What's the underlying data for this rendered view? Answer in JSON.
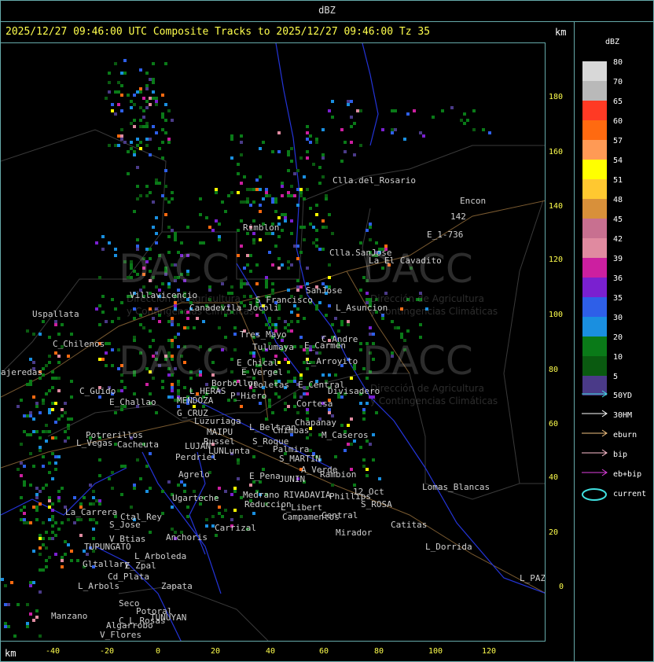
{
  "header": {
    "title": "dBZ"
  },
  "subtitle": "2025/12/27 09:46:00 UTC Composite Tracks to 2025/12/27 09:46:00 Tz 35",
  "axis": {
    "unit": "km",
    "y_ticks": [
      "180",
      "160",
      "140",
      "120",
      "100",
      "80",
      "60",
      "40",
      "20",
      "0"
    ],
    "x_ticks": [
      "-40",
      "-20",
      "0",
      "20",
      "40",
      "60",
      "80",
      "100",
      "120"
    ]
  },
  "legend": {
    "title": "dBZ",
    "levels": [
      {
        "label": "80",
        "color": "#d8d8d8"
      },
      {
        "label": "70",
        "color": "#b9b9b9"
      },
      {
        "label": "65",
        "color": "#ff3a24"
      },
      {
        "label": "60",
        "color": "#ff6a10"
      },
      {
        "label": "57",
        "color": "#ff9a55"
      },
      {
        "label": "54",
        "color": "#ffff00"
      },
      {
        "label": "51",
        "color": "#ffc830"
      },
      {
        "label": "48",
        "color": "#d8903a"
      },
      {
        "label": "45",
        "color": "#c87090"
      },
      {
        "label": "42",
        "color": "#e08aa0"
      },
      {
        "label": "39",
        "color": "#cc1fa0"
      },
      {
        "label": "36",
        "color": "#7a20d0"
      },
      {
        "label": "35",
        "color": "#2e5fe8"
      },
      {
        "label": "30",
        "color": "#1a8fe0"
      },
      {
        "label": "20",
        "color": "#0a7a18"
      },
      {
        "label": "10",
        "color": "#0a5a10"
      },
      {
        "label": "5",
        "color": "#4a3a88"
      }
    ],
    "tracks": [
      {
        "label": "50YD",
        "color": "#40e0e0"
      },
      {
        "label": "30HM",
        "color": "#ffffff"
      },
      {
        "label": "eburn",
        "color": "#f0c080"
      },
      {
        "label": "bip",
        "color": "#ffc0d0"
      },
      {
        "label": "eb+bip",
        "color": "#e040e0"
      },
      {
        "label": "current",
        "color": "#40e0e0"
      }
    ]
  },
  "watermark": {
    "brand": "DACC",
    "line1": "Dirección de Agricultura",
    "line2": "y Contingencias Climáticas"
  },
  "towns": [
    {
      "name": "Clla.del_Rosario"
    },
    {
      "name": "Encon"
    },
    {
      "name": "E_1-736"
    },
    {
      "name": "142"
    },
    {
      "name": "Rimblon"
    },
    {
      "name": "Clla.SanJose"
    },
    {
      "name": "La El Cavadito"
    },
    {
      "name": "Villavicencio"
    },
    {
      "name": "S_Francisco"
    },
    {
      "name": "SanJose"
    },
    {
      "name": "Uspallata"
    },
    {
      "name": "Canadevila"
    },
    {
      "name": "Jocoli"
    },
    {
      "name": "L_Asuncion"
    },
    {
      "name": "Tres_Mayo"
    },
    {
      "name": "C_Andre"
    },
    {
      "name": "C_Chilenos"
    },
    {
      "name": "Tulumaya"
    },
    {
      "name": "E_Carmen"
    },
    {
      "name": "E_Chical"
    },
    {
      "name": "L_Arroyito"
    },
    {
      "name": "E_Vergel"
    },
    {
      "name": "ajeredas"
    },
    {
      "name": "Borbollon"
    },
    {
      "name": "Violetas"
    },
    {
      "name": "E_Central"
    },
    {
      "name": "C_Guido"
    },
    {
      "name": "L_HERAS"
    },
    {
      "name": "P_Hiero"
    },
    {
      "name": "Divisadero"
    },
    {
      "name": "E_Challao"
    },
    {
      "name": "MENDOZA"
    },
    {
      "name": "Cortesa"
    },
    {
      "name": "G_CRUZ"
    },
    {
      "name": "Luzuriaga"
    },
    {
      "name": "Chapanay"
    },
    {
      "name": "MAIPU"
    },
    {
      "name": "L_Beltran"
    },
    {
      "name": "Potrerillos"
    },
    {
      "name": "Russel"
    },
    {
      "name": "Chimbas"
    },
    {
      "name": "M_Caseros"
    },
    {
      "name": "L_Vegas"
    },
    {
      "name": "Cacheuta"
    },
    {
      "name": "LUJAN"
    },
    {
      "name": "S_Roque"
    },
    {
      "name": "LUNLunta"
    },
    {
      "name": "Palmira"
    },
    {
      "name": "Perdriel"
    },
    {
      "name": "S_MARTIN"
    },
    {
      "name": "A_Verde"
    },
    {
      "name": "Agrelo"
    },
    {
      "name": "E_Pena"
    },
    {
      "name": "JUNIN"
    },
    {
      "name": "Rambion"
    },
    {
      "name": "12_Oct"
    },
    {
      "name": "Lomas_Blancas"
    },
    {
      "name": "Ugarteche"
    },
    {
      "name": "Medrano"
    },
    {
      "name": "RIVADAVIA"
    },
    {
      "name": "Phillips"
    },
    {
      "name": "Reduccion"
    },
    {
      "name": "S_ROSA"
    },
    {
      "name": "La_Carrera"
    },
    {
      "name": "Ctal_Rey"
    },
    {
      "name": "L_Libert"
    },
    {
      "name": "Campamentos"
    },
    {
      "name": "Central"
    },
    {
      "name": "S_Jose"
    },
    {
      "name": "Carrizal"
    },
    {
      "name": "Catitas"
    },
    {
      "name": "V_Btias"
    },
    {
      "name": "Anchoris"
    },
    {
      "name": "Mirador"
    },
    {
      "name": "TUPUNGATO"
    },
    {
      "name": "L_Dorrida"
    },
    {
      "name": "L_Arboleda"
    },
    {
      "name": "Gltallary"
    },
    {
      "name": "E_Zpal"
    },
    {
      "name": "Cd_Plata"
    },
    {
      "name": "L_Arbols"
    },
    {
      "name": "Zapata"
    },
    {
      "name": "L_PAZ"
    },
    {
      "name": "Seco"
    },
    {
      "name": "Potoral"
    },
    {
      "name": "Manzano"
    },
    {
      "name": "TUNUYAN"
    },
    {
      "name": "C_L_Rosas"
    },
    {
      "name": "V_Flores"
    },
    {
      "name": "Algarrobo"
    }
  ]
}
